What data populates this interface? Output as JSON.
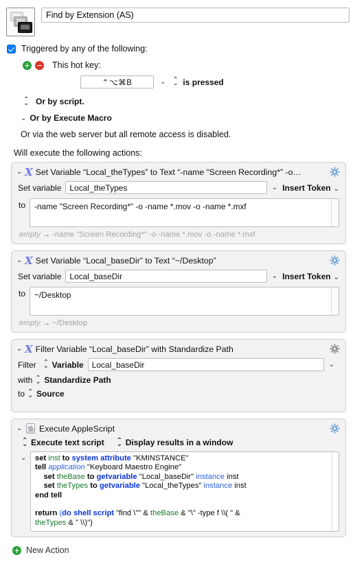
{
  "macro": {
    "icon_name": "screens-stack-icon",
    "title": "Find by Extension (AS)"
  },
  "triggers": {
    "checkbox_checked": true,
    "label": "Triggered by any of the following:",
    "add_button": "+",
    "remove_button": "−",
    "hotkey_label": "This hot key:",
    "hotkey_value": "⌃⌥⌘B",
    "hotkey_condition": "is pressed",
    "or_by_script": "Or by script.",
    "or_by_execute_macro": "Or by Execute Macro",
    "web_server_note": "Or via the web server but all remote access is disabled."
  },
  "actions_header": "Will execute the following actions:",
  "actions": [
    {
      "id": "set-variable-thetypes",
      "icon": "variable-x-icon",
      "title": "Set Variable “Local_theTypes” to Text “-name “Screen Recording*” -o…",
      "set_variable_label": "Set variable",
      "variable_name": "Local_theTypes",
      "insert_token_label": "Insert Token",
      "to_label": "to",
      "value": "-name \"Screen Recording*\" -o -name *.mov -o -name *.mxf",
      "preview_from": "empty",
      "preview_arrow": "→",
      "preview_to": "-name \"Screen Recording*\" -o -name *.mov -o -name *.mxf"
    },
    {
      "id": "set-variable-basedir",
      "icon": "variable-x-icon",
      "title": "Set Variable “Local_baseDir” to Text “~/Desktop”",
      "set_variable_label": "Set variable",
      "variable_name": "Local_baseDir",
      "insert_token_label": "Insert Token",
      "to_label": "to",
      "value": "~/Desktop",
      "preview_from": "empty",
      "preview_arrow": "→",
      "preview_to": "~/Desktop"
    },
    {
      "id": "filter-variable-basedir",
      "icon": "variable-x-icon",
      "title": "Filter Variable “Local_baseDir” with Standardize Path",
      "filter_label": "Filter",
      "filter_source_type": "Variable",
      "variable_name": "Local_baseDir",
      "with_label": "with",
      "filter_kind": "Standardize Path",
      "to_label": "to",
      "destination": "Source"
    },
    {
      "id": "execute-applescript",
      "icon": "applescript-icon",
      "title": "Execute AppleScript",
      "script_source_option": "Execute text script",
      "result_option": "Display results in a window",
      "code_lines": [
        [
          {
            "t": "set ",
            "c": "kw"
          },
          {
            "t": "inst",
            "c": "var"
          },
          {
            "t": " to ",
            "c": "kw"
          },
          {
            "t": "system attribute",
            "c": "kb"
          },
          {
            "t": " \"KMINSTANCE\"",
            "c": "str"
          }
        ],
        [
          {
            "t": "tell ",
            "c": "kw"
          },
          {
            "t": "application",
            "c": "app"
          },
          {
            "t": " \"Keyboard Maestro Engine\"",
            "c": "str"
          }
        ],
        [
          {
            "t": "    set ",
            "c": "kw"
          },
          {
            "t": "theBase",
            "c": "var"
          },
          {
            "t": " to ",
            "c": "kw"
          },
          {
            "t": "getvariable",
            "c": "kb"
          },
          {
            "t": " \"Local_baseDir\" ",
            "c": "str"
          },
          {
            "t": "instance",
            "c": "kbn"
          },
          {
            "t": " inst",
            "c": "str"
          }
        ],
        [
          {
            "t": "    set ",
            "c": "kw"
          },
          {
            "t": "theTypes",
            "c": "var"
          },
          {
            "t": " to ",
            "c": "kw"
          },
          {
            "t": "getvariable",
            "c": "kb"
          },
          {
            "t": " \"Local_theTypes\" ",
            "c": "str"
          },
          {
            "t": "instance",
            "c": "kbn"
          },
          {
            "t": " inst",
            "c": "str"
          }
        ],
        [
          {
            "t": "end tell",
            "c": "kw"
          }
        ],
        [
          {
            "t": "",
            "c": "str"
          }
        ],
        [
          {
            "t": "return ",
            "c": "kw"
          },
          {
            "t": "(",
            "c": "kbn"
          },
          {
            "t": "do shell script",
            "c": "kb"
          },
          {
            "t": " \"find \\\"\" ",
            "c": "str"
          },
          {
            "t": "&",
            "c": "str"
          },
          {
            "t": " theBase ",
            "c": "var"
          },
          {
            "t": "&",
            "c": "str"
          },
          {
            "t": " \"\\\" -type f \\\\( \" ",
            "c": "str"
          },
          {
            "t": "&",
            "c": "str"
          },
          {
            "t": "\ntheTypes",
            "c": "var"
          },
          {
            "t": " & \" \\\\)\")",
            "c": "str"
          }
        ]
      ]
    }
  ],
  "footer": {
    "new_action_label": "New Action",
    "new_action_icon": "plus-circle-icon"
  },
  "colors": {
    "accent_blue": "#0a7cf4",
    "add_green": "#28a03a",
    "remove_red": "#d8352a",
    "variable_icon_purple": "#6d78e0",
    "gear_blue": "#7fa9d8",
    "code_keyword_blue": "#0b35d8",
    "code_variable_green": "#1a7a2e",
    "preview_gray": "#a4a4a4",
    "action_bg": "#f2f2f2"
  }
}
